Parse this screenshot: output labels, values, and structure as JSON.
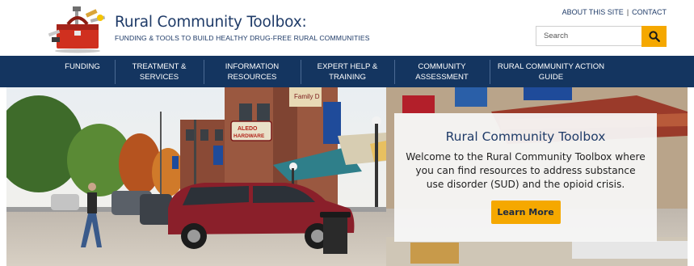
{
  "brand": {
    "title": "Rural Community Toolbox:",
    "subtitle": "FUNDING & TOOLS TO BUILD HEALTHY DRUG-FREE RURAL COMMUNITIES",
    "logo_icon": "toolbox-icon"
  },
  "top_links": {
    "about": "ABOUT THIS SITE",
    "separator": "|",
    "contact": "CONTACT"
  },
  "search": {
    "placeholder": "Search",
    "button_icon": "search-icon",
    "button_color": "#f5a800"
  },
  "nav": {
    "items": [
      {
        "line1": "FUNDING",
        "line2": ""
      },
      {
        "line1": "TREATMENT &",
        "line2": "SERVICES"
      },
      {
        "line1": "INFORMATION",
        "line2": "RESOURCES"
      },
      {
        "line1": "EXPERT HELP &",
        "line2": "TRAINING"
      },
      {
        "line1": "COMMUNITY",
        "line2": "ASSESSMENT"
      },
      {
        "line1": "RURAL COMMUNITY ACTION",
        "line2": "GUIDE"
      }
    ],
    "background": "#143560"
  },
  "hero": {
    "image_description_icon": "main-street-photo",
    "sign_text": "ALEDO HARDWARE",
    "card": {
      "title": "Rural Community Toolbox",
      "body": "Welcome to the Rural Community Toolbox where you can find resources to address substance use disorder (SUD) and the opioid crisis.",
      "button": "Learn More"
    }
  },
  "colors": {
    "brand_blue": "#1f3b68",
    "accent_gold": "#f5a800"
  }
}
